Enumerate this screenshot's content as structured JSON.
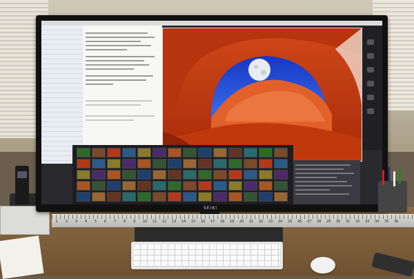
{
  "scene": {
    "monitor_brand": "SEIKI",
    "photo_subject": "red sandstone arch with moon",
    "colors": {
      "rock": "#c63d10",
      "sky": "#1f4fd8",
      "moon": "#e7ecf1",
      "desk": "#7a5c3a"
    }
  },
  "ruler": {
    "numbers": [
      "1",
      "2",
      "3",
      "4",
      "5",
      "6",
      "7",
      "8",
      "9",
      "10",
      "11",
      "12",
      "13",
      "14",
      "15",
      "16",
      "17",
      "18",
      "19",
      "20",
      "21",
      "22",
      "23",
      "24",
      "25",
      "26",
      "27",
      "28",
      "29",
      "30",
      "31",
      "32",
      "33",
      "34",
      "35",
      "36"
    ]
  },
  "icons": [
    "phone-icon",
    "mouse-icon",
    "keyboard-icon"
  ]
}
